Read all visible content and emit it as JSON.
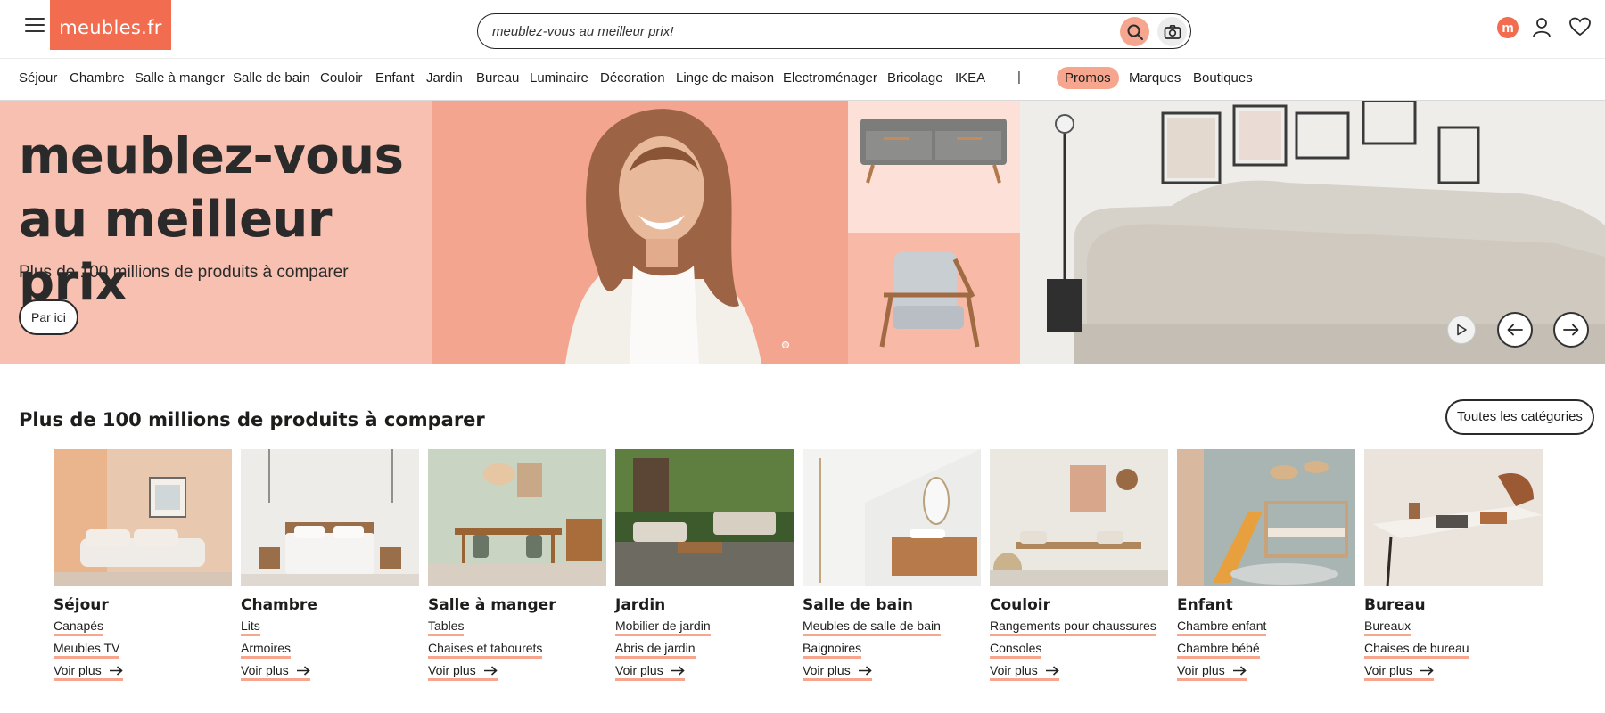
{
  "header": {
    "logo": "meubles.fr",
    "search_placeholder": "meublez-vous au meilleur prix!",
    "brand_badge": "m"
  },
  "nav": {
    "items": [
      "Séjour",
      "Chambre",
      "Salle à manger",
      "Salle de bain",
      "Couloir",
      "Enfant",
      "Jardin",
      "Bureau",
      "Luminaire",
      "Décoration",
      "Linge de maison",
      "Electroménager",
      "Bricolage",
      "IKEA"
    ],
    "separator": "|",
    "promo": "Promos",
    "extra": [
      "Marques",
      "Boutiques"
    ]
  },
  "hero": {
    "title_line1": "meublez-vous",
    "title_line2": "au meilleur prix",
    "subtitle": "Plus de 100 millions de produits à comparer",
    "cta": "Par ici"
  },
  "section": {
    "title": "Plus de 100 millions de produits à comparer",
    "all_categories": "Toutes les catégories"
  },
  "categories": [
    {
      "name": "Séjour",
      "links": [
        "Canapés",
        "Meubles TV"
      ],
      "more": "Voir plus"
    },
    {
      "name": "Chambre",
      "links": [
        "Lits",
        "Armoires"
      ],
      "more": "Voir plus"
    },
    {
      "name": "Salle à manger",
      "links": [
        "Tables",
        "Chaises et tabourets"
      ],
      "more": "Voir plus"
    },
    {
      "name": "Jardin",
      "links": [
        "Mobilier de jardin",
        "Abris de jardin"
      ],
      "more": "Voir plus"
    },
    {
      "name": "Salle de bain",
      "links": [
        "Meubles de salle de bain",
        "Baignoires"
      ],
      "more": "Voir plus"
    },
    {
      "name": "Couloir",
      "links": [
        "Rangements pour chaussures",
        "Consoles"
      ],
      "more": "Voir plus"
    },
    {
      "name": "Enfant",
      "links": [
        "Chambre enfant",
        "Chambre bébé"
      ],
      "more": "Voir plus"
    },
    {
      "name": "Bureau",
      "links": [
        "Bureaux",
        "Chaises de bureau"
      ],
      "more": "Voir plus"
    }
  ],
  "colors": {
    "brand": "#f26c4f",
    "hero_peach": "#f7c0b0",
    "accent_underline": "#f6a68f"
  }
}
